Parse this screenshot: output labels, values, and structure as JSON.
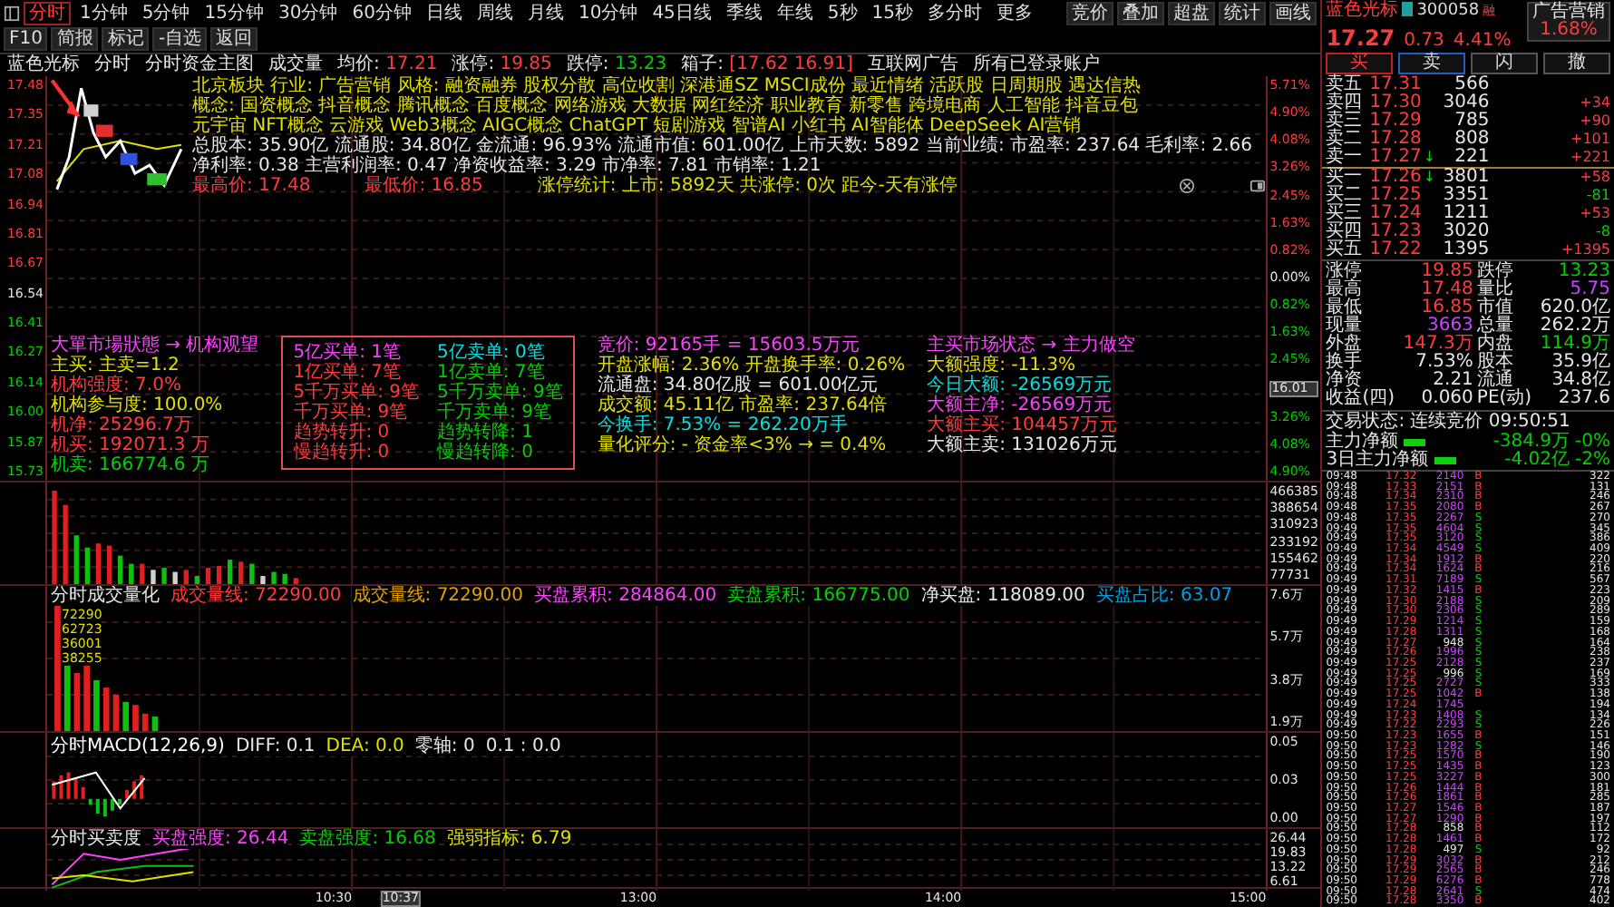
{
  "toolbar": {
    "tabs": [
      {
        "label": "分时",
        "selected": true
      },
      {
        "label": "1分钟",
        "selected": false
      },
      {
        "label": "5分钟",
        "selected": false
      },
      {
        "label": "15分钟",
        "selected": false
      },
      {
        "label": "30分钟",
        "selected": false
      },
      {
        "label": "60分钟",
        "selected": false
      },
      {
        "label": "日线",
        "selected": false
      },
      {
        "label": "周线",
        "selected": false
      },
      {
        "label": "月线",
        "selected": false
      },
      {
        "label": "10分钟",
        "selected": false
      },
      {
        "label": "45日线",
        "selected": false
      },
      {
        "label": "季线",
        "selected": false
      },
      {
        "label": "年线",
        "selected": false
      },
      {
        "label": "5秒",
        "selected": false
      },
      {
        "label": "15秒",
        "selected": false
      },
      {
        "label": "多分时",
        "selected": false
      },
      {
        "label": "更多",
        "selected": false
      }
    ],
    "buttons": [
      "竞价",
      "叠加",
      "超盘",
      "统计",
      "画线",
      "F10",
      "简报",
      "标记",
      "-自选",
      "返回"
    ]
  },
  "quote_line": [
    {
      "label": "蓝色光标"
    },
    {
      "label": "分时"
    },
    {
      "label": "分时资金主图"
    },
    {
      "label": "成交量"
    },
    {
      "label": "均价:",
      "value": "17.21",
      "color": "#ff3c3c"
    },
    {
      "label": "涨停:",
      "value": "19.85",
      "color": "#ff3c3c"
    },
    {
      "label": "跌停:",
      "value": "13.23",
      "color": "#00d000"
    },
    {
      "label": "箱子:",
      "value": "[17.62 16.91]",
      "color": "#ff3c3c"
    },
    {
      "label": "互联网广告"
    },
    {
      "label": "所有已登录账户"
    }
  ],
  "price_chart": {
    "info_lines": [
      {
        "text": "北京板块  行业: 广告营销  风格: 融资融券 股权分散 高位收割 深港通SZ MSCI成份 最近情绪 活跃股 日周期股 遇达信热",
        "color": "#e0e000"
      },
      {
        "text": "概念: 国资概念 抖音概念 腾讯概念 百度概念 网络游戏 大数据 网红经济 职业教育 新零售 跨境电商 人工智能 抖音豆包",
        "color": "#e0e000"
      },
      {
        "text": "元宇宙 NFT概念 云游戏 Web3概念 AIGC概念 ChatGPT 短剧游戏 智谱AI 小红书 AI智能体 DeepSeek AI营销",
        "color": "#e0e000"
      },
      {
        "text": "总股本: 35.90亿  流通股: 34.80亿  金流通: 96.93%  流通市值: 601.00亿  上市天数: 5892  当前业绩:  市盈率: 237.64  毛利率: 2.66",
        "color": "#e6e6e6"
      },
      {
        "text": "净利率: 0.38  主营利润率: 0.47  净资收益率: 3.29  市净率: 7.81  市销率: 1.21",
        "color": "#e6e6e6"
      }
    ],
    "high_low": [
      {
        "text": "最高价: 17.48",
        "color": "#ff3c3c"
      },
      {
        "text": "最低价: 16.85",
        "color": "#ff3c3c"
      },
      {
        "text": "涨停统计:  上市: 5892天  共涨停: 0次  距今-天有涨停",
        "color": "#e0e000"
      }
    ],
    "price_axis": {
      "above": [
        "17.48",
        "17.35",
        "17.21",
        "17.08",
        "16.94",
        "16.81",
        "16.67"
      ],
      "base": "16.54",
      "below": [
        "16.41",
        "16.27",
        "16.14",
        "16.00",
        "15.87",
        "15.73"
      ]
    },
    "pct_axis": {
      "above": [
        "5.71%",
        "4.90%",
        "4.08%",
        "3.26%",
        "2.45%",
        "1.63%",
        "0.82%"
      ],
      "base": "0.00%",
      "below": [
        "0.82%",
        "1.63%",
        "2.45%",
        "3.26%",
        "4.08%",
        "4.90%"
      ]
    },
    "cursor_price": "16.01",
    "left_stats": [
      {
        "text": "大單市場狀態 → 机构观望",
        "color": "#ff40ff"
      },
      {
        "text": "主买: 主卖=1.2",
        "color": "#e0e000"
      },
      {
        "text": "机构强度: 7.0%",
        "color": "#ff3c3c"
      },
      {
        "text": "机构参与度: 100.0%",
        "color": "#e0e000"
      },
      {
        "text": "机净: 25296.7万",
        "color": "#ff3c3c"
      },
      {
        "text": "机买: 192071.3 万",
        "color": "#ff3c3c"
      },
      {
        "text": "机卖: 166774.6 万",
        "color": "#00d000"
      }
    ],
    "order_box": [
      {
        "buy": {
          "text": "5亿买单: 1笔",
          "color": "#ff40ff"
        },
        "sell": {
          "text": "5亿卖单: 0笔",
          "color": "#00e0e0"
        }
      },
      {
        "buy": {
          "text": "1亿买单: 7笔",
          "color": "#ff3c3c"
        },
        "sell": {
          "text": "1亿卖单: 7笔",
          "color": "#00d000"
        }
      },
      {
        "buy": {
          "text": "5千万买单: 9笔",
          "color": "#ff3c3c"
        },
        "sell": {
          "text": "5千万卖单: 9笔",
          "color": "#00d000"
        }
      },
      {
        "buy": {
          "text": "千万买单: 9笔",
          "color": "#ff3c3c"
        },
        "sell": {
          "text": "千万卖单: 9笔",
          "color": "#00d000"
        }
      },
      {
        "buy": {
          "text": "趋势转升: 0",
          "color": "#ff3c3c"
        },
        "sell": {
          "text": "趋势转降: 1",
          "color": "#00d000"
        }
      },
      {
        "buy": {
          "text": "慢趋转升: 0",
          "color": "#ff3c3c"
        },
        "sell": {
          "text": "慢趋转降: 0",
          "color": "#00d000"
        }
      }
    ],
    "mid_stats": [
      {
        "text": "竞价: 92165手 = 15603.5万元",
        "color": "#ff40ff"
      },
      {
        "text": "开盘涨幅: 2.36%   开盘换手率: 0.26%",
        "color": "#e0e000"
      },
      {
        "text": "流通盘: 34.80亿股 = 601.00亿元",
        "color": "#e6e6e6"
      },
      {
        "text": "成交额: 45.11亿   市盈率: 237.64倍",
        "color": "#e0e000"
      },
      {
        "text": "今换手: 7.53% = 262.20万手",
        "color": "#00e0e0"
      },
      {
        "text": "量化评分: -   资金率<3% → = 0.4%",
        "color": "#e0e000"
      }
    ],
    "right_stats": [
      {
        "text": "主买市场状态 → 主力做空",
        "color": "#ff40ff"
      },
      {
        "text": "大额强度: -11.3%",
        "color": "#e0e000"
      },
      {
        "text": "今日大额: -26569万元",
        "color": "#00e0e0"
      },
      {
        "text": "大额主净: -26569万元",
        "color": "#ff40ff"
      },
      {
        "text": "大额主买: 104457万元",
        "color": "#ff3c3c"
      },
      {
        "text": "大额主卖: 131026万元",
        "color": "#e6e6e6"
      }
    ]
  },
  "volume": {
    "axis": [
      "466385",
      "388654",
      "310923",
      "233192",
      "155462",
      "77731"
    ]
  },
  "volume_indicator": {
    "items": [
      {
        "text": "分时成交量化",
        "color": "#e6e6e6"
      },
      {
        "text": "成交量线: 72290.00",
        "color": "#ff3c3c"
      },
      {
        "text": "成交量线: 72290.00",
        "color": "#e0a000"
      },
      {
        "text": "买盘累积: 284864.00",
        "color": "#ff40ff"
      },
      {
        "text": "卖盘累积: 166775.00",
        "color": "#00d000"
      },
      {
        "text": "净买盘: 118089.00",
        "color": "#e6e6e6"
      },
      {
        "text": "买盘占比: 63.07",
        "color": "#00a0e0"
      }
    ],
    "bar_labels": [
      "72290",
      "62723",
      "36001",
      "38255"
    ],
    "axis": [
      "7.6万",
      "5.7万",
      "3.8万",
      "1.9万"
    ]
  },
  "macd": {
    "items": [
      {
        "text": "分时MACD(12,26,9)",
        "color": "#ffffff"
      },
      {
        "text": "DIFF: 0.1",
        "color": "#e6e6e6"
      },
      {
        "text": "DEA: 0.0",
        "color": "#e0e000"
      },
      {
        "text": "零轴: 0",
        "color": "#e6e6e6"
      },
      {
        "text": "0.1 : 0.0",
        "color": "#e6e6e6"
      }
    ],
    "axis": [
      "0.05",
      "0.03",
      "0.00"
    ]
  },
  "buy_sell": {
    "items": [
      {
        "text": "分时买卖度",
        "color": "#e6e6e6"
      },
      {
        "text": "买盘强度: 26.44",
        "color": "#ff40ff"
      },
      {
        "text": "卖盘强度: 16.68",
        "color": "#00d000"
      },
      {
        "text": "强弱指标: 6.79",
        "color": "#e0e000"
      }
    ],
    "axis": [
      "26.44",
      "19.83",
      "13.22",
      "6.61"
    ]
  },
  "time_axis": {
    "labels": [
      "10:30",
      "13:00",
      "14:00",
      "15:00"
    ],
    "cursor": "10:37"
  },
  "quote": {
    "name": "蓝色光标",
    "code": "300058",
    "tag": "融",
    "sector": "广告营销",
    "sector_pct": "1.68%",
    "price": "17.27",
    "change": "0.73",
    "pct": "4.41%",
    "trade_buttons": [
      "买",
      "卖",
      "闪",
      "撤"
    ],
    "asks": [
      {
        "label": "卖五",
        "price": "17.31",
        "volume": "566"
      },
      {
        "label": "卖四",
        "price": "17.30",
        "volume": "3046",
        "delta": "+34"
      },
      {
        "label": "卖三",
        "price": "17.29",
        "volume": "785",
        "delta": "+90"
      },
      {
        "label": "卖二",
        "price": "17.28",
        "volume": "808",
        "delta": "+101"
      },
      {
        "label": "卖一",
        "price": "17.27",
        "volume": "221",
        "delta": "+221",
        "trend": "↓"
      }
    ],
    "bids": [
      {
        "label": "买一",
        "price": "17.26",
        "volume": "3801",
        "delta": "+58",
        "trend": "↓"
      },
      {
        "label": "买二",
        "price": "17.25",
        "volume": "3351",
        "delta": "-81"
      },
      {
        "label": "买三",
        "price": "17.24",
        "volume": "1211",
        "delta": "+53"
      },
      {
        "label": "买四",
        "price": "17.23",
        "volume": "3020",
        "delta": "-8"
      },
      {
        "label": "买五",
        "price": "17.22",
        "volume": "1395",
        "delta": "+1395"
      }
    ],
    "stats": [
      {
        "label": "涨停",
        "value": "19.85",
        "color": "#ff3c3c"
      },
      {
        "label": "跌停",
        "value": "13.23",
        "color": "#00d000"
      },
      {
        "label": "最高",
        "value": "17.48",
        "color": "#ff3c3c"
      },
      {
        "label": "量比",
        "value": "5.75",
        "color": "#cc44ff"
      },
      {
        "label": "最低",
        "value": "16.85",
        "color": "#ff3c3c"
      },
      {
        "label": "市值",
        "value": "620.0亿",
        "color": "#e6e6e6"
      },
      {
        "label": "现量",
        "value": "3663",
        "color": "#cc44ff"
      },
      {
        "label": "总量",
        "value": "262.2万",
        "color": "#e6e6e6"
      },
      {
        "label": "外盘",
        "value": "147.3万",
        "color": "#ff3c3c"
      },
      {
        "label": "内盘",
        "value": "114.9万",
        "color": "#00d000"
      },
      {
        "label": "换手",
        "value": "7.53%",
        "color": "#e6e6e6"
      },
      {
        "label": "股本",
        "value": "35.9亿",
        "color": "#e6e6e6"
      },
      {
        "label": "净资",
        "value": "2.21",
        "color": "#e6e6e6"
      },
      {
        "label": "流通",
        "value": "34.8亿",
        "color": "#e6e6e6"
      },
      {
        "label": "收益(四)",
        "value": "0.060",
        "color": "#e6e6e6"
      },
      {
        "label": "PE(动)",
        "value": "237.6",
        "color": "#e6e6e6"
      }
    ],
    "status": "交易状态: 连续竞价 09:50:51",
    "flows": [
      {
        "label": "主力净额",
        "value": "-384.9万",
        "pct": "-0%"
      },
      {
        "label": "3日主力净额",
        "value": "-4.02亿",
        "pct": "-2%"
      }
    ],
    "trades": [
      {
        "time": "09:48",
        "price": "17.32",
        "volume": "2140",
        "side": "B",
        "kind": "buy",
        "count": "322"
      },
      {
        "time": "09:48",
        "price": "17.33",
        "volume": "2151",
        "side": "B",
        "kind": "buy",
        "count": "131"
      },
      {
        "time": "09:48",
        "price": "17.34",
        "volume": "2310",
        "side": "B",
        "kind": "buy",
        "count": "246"
      },
      {
        "time": "09:48",
        "price": "17.35",
        "volume": "2080",
        "side": "B",
        "kind": "buy",
        "count": "267"
      },
      {
        "time": "09:48",
        "price": "17.35",
        "volume": "2267",
        "side": "S",
        "kind": "sell",
        "count": "270"
      },
      {
        "time": "09:49",
        "price": "17.35",
        "volume": "4604",
        "side": "S",
        "kind": "sell",
        "count": "345"
      },
      {
        "time": "09:49",
        "price": "17.35",
        "volume": "3120",
        "side": "S",
        "kind": "sell",
        "count": "386"
      },
      {
        "time": "09:49",
        "price": "17.34",
        "volume": "4549",
        "side": "S",
        "kind": "sell",
        "count": "409"
      },
      {
        "time": "09:49",
        "price": "17.34",
        "volume": "1912",
        "side": "B",
        "kind": "buy",
        "count": "220"
      },
      {
        "time": "09:49",
        "price": "17.34",
        "volume": "1624",
        "side": "B",
        "kind": "buy",
        "count": "216"
      },
      {
        "time": "09:49",
        "price": "17.31",
        "volume": "7189",
        "side": "S",
        "kind": "sell",
        "count": "567"
      },
      {
        "time": "09:49",
        "price": "17.32",
        "volume": "1415",
        "side": "B",
        "kind": "buy",
        "count": "223"
      },
      {
        "time": "09:49",
        "price": "17.30",
        "volume": "2188",
        "side": "S",
        "kind": "sell",
        "count": "209"
      },
      {
        "time": "09:49",
        "price": "17.30",
        "volume": "2306",
        "side": "S",
        "kind": "sell",
        "count": "289"
      },
      {
        "time": "09:49",
        "price": "17.29",
        "volume": "1214",
        "side": "S",
        "kind": "sell",
        "count": "159"
      },
      {
        "time": "09:49",
        "price": "17.28",
        "volume": "1311",
        "side": "S",
        "kind": "sell",
        "count": "168"
      },
      {
        "time": "09:49",
        "price": "17.27",
        "volume": "948",
        "side": "S",
        "kind": "sell",
        "count": "164"
      },
      {
        "time": "09:49",
        "price": "17.26",
        "volume": "1996",
        "side": "S",
        "kind": "sell",
        "count": "238"
      },
      {
        "time": "09:49",
        "price": "17.25",
        "volume": "2128",
        "side": "S",
        "kind": "sell",
        "count": "237"
      },
      {
        "time": "09:49",
        "price": "17.25",
        "volume": "996",
        "side": "S",
        "kind": "sell",
        "count": "169"
      },
      {
        "time": "09:49",
        "price": "17.25",
        "volume": "2727",
        "side": "S",
        "kind": "sell",
        "count": "333"
      },
      {
        "time": "09:49",
        "price": "17.25",
        "volume": "1042",
        "side": "B",
        "kind": "buy",
        "count": "138"
      },
      {
        "time": "09:49",
        "price": "17.24",
        "volume": "1745",
        "kind": "none",
        "count": "194"
      },
      {
        "time": "09:49",
        "price": "17.23",
        "volume": "1408",
        "side": "S",
        "kind": "sell",
        "count": "134"
      },
      {
        "time": "09:49",
        "price": "17.22",
        "volume": "2293",
        "side": "S",
        "kind": "sell",
        "count": "226"
      },
      {
        "time": "09:50",
        "price": "17.23",
        "volume": "1655",
        "side": "B",
        "kind": "buy",
        "count": "151"
      },
      {
        "time": "09:50",
        "price": "17.23",
        "volume": "1282",
        "side": "S",
        "kind": "sell",
        "count": "146"
      },
      {
        "time": "09:50",
        "price": "17.25",
        "volume": "1570",
        "side": "B",
        "kind": "buy",
        "count": "190"
      },
      {
        "time": "09:50",
        "price": "17.25",
        "volume": "1435",
        "side": "B",
        "kind": "buy",
        "count": "123"
      },
      {
        "time": "09:50",
        "price": "17.25",
        "volume": "3227",
        "side": "B",
        "kind": "buy",
        "count": "300"
      },
      {
        "time": "09:50",
        "price": "17.26",
        "volume": "1444",
        "side": "B",
        "kind": "buy",
        "count": "181"
      },
      {
        "time": "09:50",
        "price": "17.26",
        "volume": "1861",
        "side": "B",
        "kind": "buy",
        "count": "285"
      },
      {
        "time": "09:50",
        "price": "17.27",
        "volume": "1546",
        "side": "B",
        "kind": "buy",
        "count": "187"
      },
      {
        "time": "09:50",
        "price": "17.27",
        "volume": "1290",
        "side": "B",
        "kind": "buy",
        "count": "197"
      },
      {
        "time": "09:50",
        "price": "17.28",
        "volume": "858",
        "side": "B",
        "kind": "buy",
        "count": "112"
      },
      {
        "time": "09:50",
        "price": "17.28",
        "volume": "1461",
        "side": "B",
        "kind": "buy",
        "count": "172"
      },
      {
        "time": "09:50",
        "price": "17.28",
        "volume": "497",
        "side": "S",
        "kind": "sell",
        "count": "92"
      },
      {
        "time": "09:50",
        "price": "17.29",
        "volume": "3032",
        "side": "B",
        "kind": "buy",
        "count": "212"
      },
      {
        "time": "09:50",
        "price": "17.29",
        "volume": "2565",
        "side": "B",
        "kind": "buy",
        "count": "246"
      },
      {
        "time": "09:50",
        "price": "17.29",
        "volume": "6276",
        "side": "B",
        "kind": "buy",
        "count": "778"
      },
      {
        "time": "09:50",
        "price": "17.28",
        "volume": "2641",
        "side": "S",
        "kind": "sell",
        "count": "474"
      },
      {
        "time": "09:50",
        "price": "17.28",
        "volume": "3350",
        "side": "B",
        "kind": "buy",
        "count": "402"
      }
    ]
  }
}
